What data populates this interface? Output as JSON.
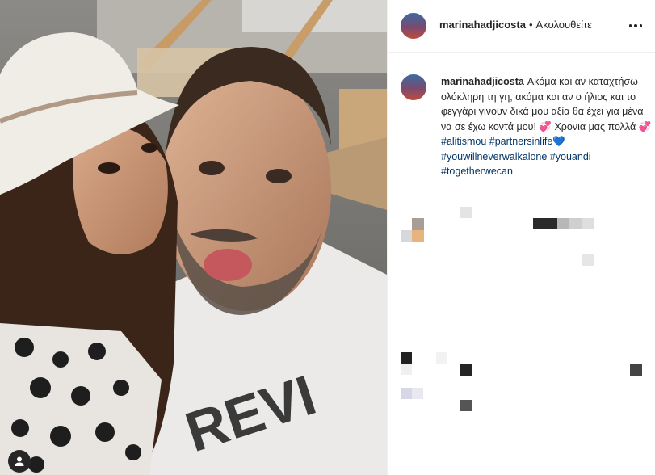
{
  "post": {
    "username": "marinahadjicosta",
    "separator": "•",
    "follow_status": "Ακολουθείτε",
    "caption": {
      "username": "marinahadjicosta",
      "text": "Ακόμα και αν καταχτήσω ολόκληρη τη γη, ακόμα και αν ο ήλιος και το φεγγάρι γίνουν δικά μου αξία θα έχει για μένα να σε έχω κοντά μου! 💞 Χρονια μας πολλά 💞",
      "hashtags": [
        "#alitismou",
        "#partnersinlife",
        "#youwillneverwalkalone",
        "#youandi",
        "#togetherwecan"
      ],
      "trailing_emoji": "💙"
    }
  },
  "icons": {
    "more": "more-options-icon",
    "user_tag": "user-tag-icon"
  },
  "colors": {
    "text": "#262626",
    "hashtag": "#003569",
    "border": "#efefef"
  }
}
